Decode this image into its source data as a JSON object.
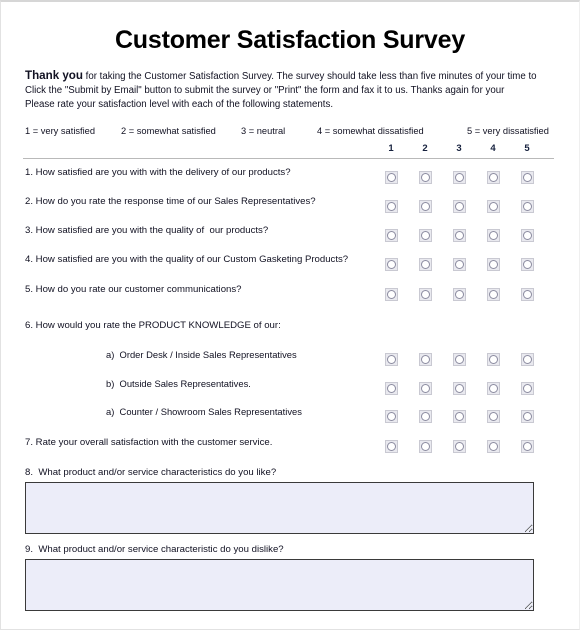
{
  "document": {
    "title": "Customer Satisfaction Survey",
    "intro": {
      "lead": "Thank you",
      "line1_rest": " for taking the Customer Satisfaction Survey. The survey should take less than five minutes of your time to",
      "line2": "Click the \"Submit by Email\" button to submit the survey or \"Print\" the form and fax it to us.  Thanks again for your",
      "line3": "Please rate your satisfaction level with each of the following statements."
    }
  },
  "scale": {
    "legend": [
      "1 = very satisfied",
      "2 = somewhat satisfied",
      "3 = neutral",
      "4 = somewhat dissatisfied",
      "5 = very dissatisfied"
    ],
    "column_numbers": [
      "1",
      "2",
      "3",
      "4",
      "5"
    ]
  },
  "questions": [
    {
      "text": "1. How satisfied are you with with the delivery of our products?",
      "indent": false
    },
    {
      "text": "2. How do you rate the response time of our Sales Representatives?",
      "indent": false
    },
    {
      "text": "3. How satisfied are you with the quality of  our products?",
      "indent": false
    },
    {
      "text": "4. How satisfied are you with the quality of our Custom Gasketing Products?",
      "indent": false
    },
    {
      "text": "5. How do you rate our customer communications?",
      "indent": false
    },
    {
      "text": "6. How would you rate the PRODUCT KNOWLEDGE of our:",
      "indent": false
    },
    {
      "text": "a)  Order Desk / Inside Sales Representatives",
      "indent": true
    },
    {
      "text": "b)  Outside Sales Representatives.",
      "indent": true
    },
    {
      "text": "a)  Counter / Showroom Sales Representatives",
      "indent": true
    },
    {
      "text": "7. Rate your overall satisfaction with the customer service.",
      "indent": false
    }
  ],
  "free_text": [
    {
      "label": "8.  What product and/or service characteristics do you like?",
      "value": "",
      "placeholder": ""
    },
    {
      "label": "9.  What product and/or service characteristic do you dislike?",
      "value": "",
      "placeholder": ""
    }
  ],
  "colors": {
    "field_fill": "#ecedf9",
    "field_border": "#3a3a3a",
    "radio_fill": "#e9e9ef",
    "text": "#111122",
    "rule": "#b9b9b9"
  }
}
